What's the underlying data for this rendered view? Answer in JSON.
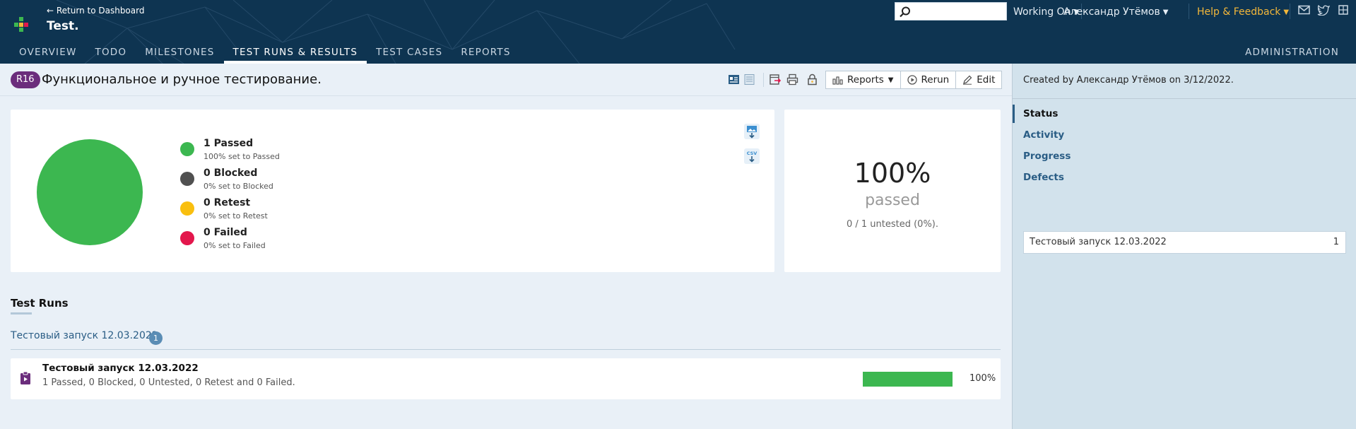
{
  "header": {
    "back_link": "← Return to Dashboard",
    "project_title": "Test.",
    "search": {
      "value": "",
      "placeholder": ""
    },
    "working_on": "Working On",
    "user": "Александр Утёмов",
    "help": "Help & Feedback",
    "icons": [
      "mail-icon",
      "twitter-icon",
      "grid-icon"
    ]
  },
  "nav": {
    "items": [
      "OVERVIEW",
      "TODO",
      "MILESTONES",
      "TEST RUNS & RESULTS",
      "TEST CASES",
      "REPORTS"
    ],
    "active": "TEST RUNS & RESULTS",
    "admin": "ADMINISTRATION"
  },
  "run": {
    "badge": "R16",
    "title": "Функциональное и ручное тестирование.",
    "buttons": {
      "reports": "Reports",
      "rerun": "Rerun",
      "edit": "Edit"
    }
  },
  "summary": {
    "legend": [
      {
        "label": "1 Passed",
        "sub": "100% set to Passed",
        "color": "#3cb750"
      },
      {
        "label": "0 Blocked",
        "sub": "0% set to Blocked",
        "color": "#505050"
      },
      {
        "label": "0 Retest",
        "sub": "0% set to Retest",
        "color": "#f9bf0f"
      },
      {
        "label": "0 Failed",
        "sub": "0% set to Failed",
        "color": "#e3174c"
      }
    ],
    "percent": "100%",
    "percent_label": "passed",
    "untested": "0 / 1 untested (0%)."
  },
  "chart_data": {
    "type": "pie",
    "categories": [
      "Passed",
      "Blocked",
      "Retest",
      "Failed"
    ],
    "values": [
      1,
      0,
      0,
      0
    ],
    "colors": [
      "#3cb750",
      "#505050",
      "#f9bf0f",
      "#e3174c"
    ]
  },
  "test_runs": {
    "section_title": "Test Runs",
    "group_title": "Тестовый запуск 12.03.2022",
    "group_count": "1",
    "rows": [
      {
        "name": "Тестовый запуск 12.03.2022",
        "stats": "1 Passed, 0 Blocked, 0 Untested, 0 Retest and 0 Failed.",
        "progress": 1.0,
        "progress_text": "100%"
      }
    ]
  },
  "sidebar": {
    "created": "Created by Александр Утёмов on 3/12/2022.",
    "nav": [
      "Status",
      "Activity",
      "Progress",
      "Defects"
    ],
    "active": "Status",
    "run_name": "Тестовый запуск 12.03.2022",
    "run_count": "1"
  },
  "colors": {
    "header_bg": "#0e3451",
    "accent_link": "#2a5d85",
    "help_link": "#f3b73a",
    "passed": "#3cb750",
    "badge": "#6b2d7c"
  }
}
